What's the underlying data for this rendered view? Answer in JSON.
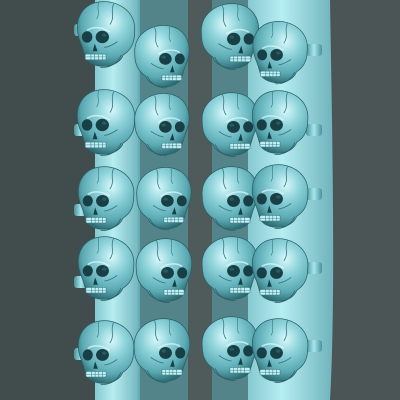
{
  "scene": {
    "subject": "",
    "colors": {
      "background_left": "#414c4d",
      "background_center": "#4f5a5b",
      "background_right": "#4b5556",
      "sprue_light": "#a3e0e6",
      "sprue_mid": "#7fc2c9",
      "sprue_dark": "#5fa3ab",
      "skull_base": "#6fc3cc",
      "skull_highlight": "#cdf4f7",
      "skull_shadow": "#3d7d86",
      "cavity": "#173f45"
    }
  }
}
